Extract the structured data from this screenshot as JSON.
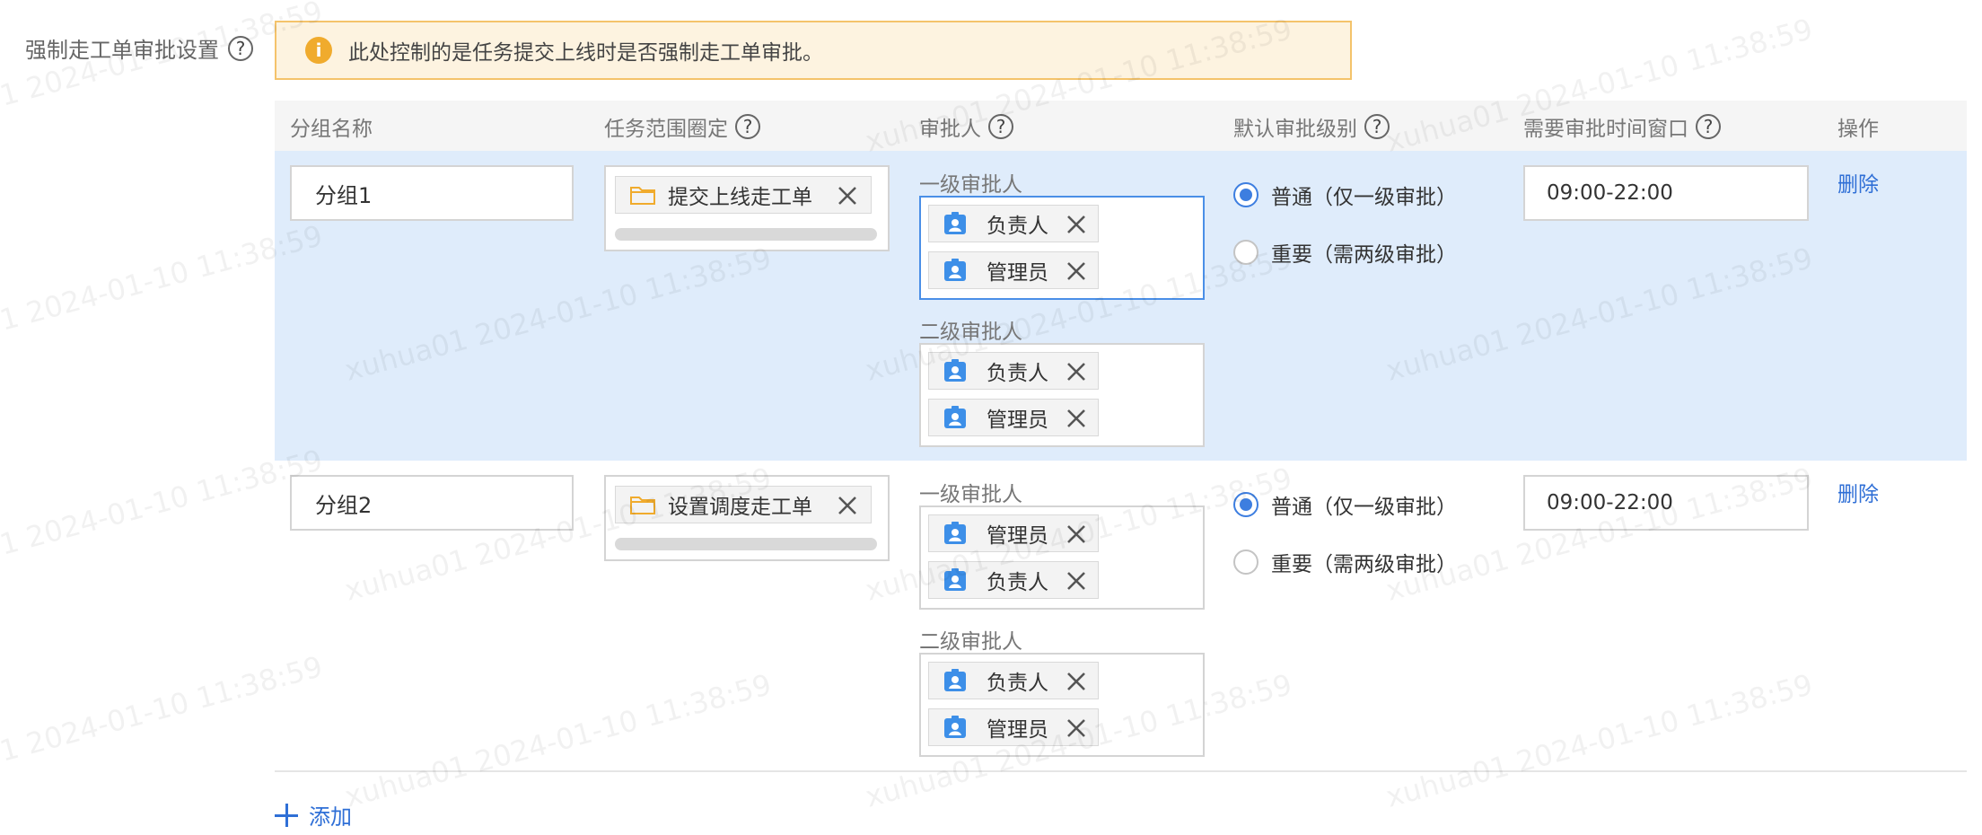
{
  "setting": {
    "label": "强制走工单审批设置",
    "help": "?"
  },
  "alert": {
    "icon_text": "i",
    "text": "此处控制的是任务提交上线时是否强制走工单审批。"
  },
  "table": {
    "headers": {
      "group_name": "分组名称",
      "scope": "任务范围圈定",
      "approver": "审批人",
      "default_level": "默认审批级别",
      "time_window": "需要审批时间窗口",
      "action": "操作"
    },
    "help": "?",
    "rows": [
      {
        "name": "分组1",
        "scope_tag": "提交上线走工单",
        "level1_label": "一级审批人",
        "level1": [
          "负责人",
          "管理员"
        ],
        "level2_label": "二级审批人",
        "level2": [
          "负责人",
          "管理员"
        ],
        "radio_normal": "普通（仅一级审批）",
        "radio_important": "重要（需两级审批）",
        "selected_level": "普通（仅一级审批）",
        "time_window": "09:00-22:00",
        "delete": "删除"
      },
      {
        "name": "分组2",
        "scope_tag": "设置调度走工单",
        "level1_label": "一级审批人",
        "level1": [
          "管理员",
          "负责人"
        ],
        "level2_label": "二级审批人",
        "level2": [
          "负责人",
          "管理员"
        ],
        "radio_normal": "普通（仅一级审批）",
        "radio_important": "重要（需两级审批）",
        "selected_level": "普通（仅一级审批）",
        "time_window": "09:00-22:00",
        "delete": "删除"
      }
    ]
  },
  "add_button": "添加",
  "watermark": "xuhua01 2024-01-10 11:38:59",
  "colors": {
    "accent": "#2f6fd6",
    "selected_row": "#dfecfb",
    "alert_bg": "#fdf3e0",
    "alert_border": "#f4c36b"
  }
}
